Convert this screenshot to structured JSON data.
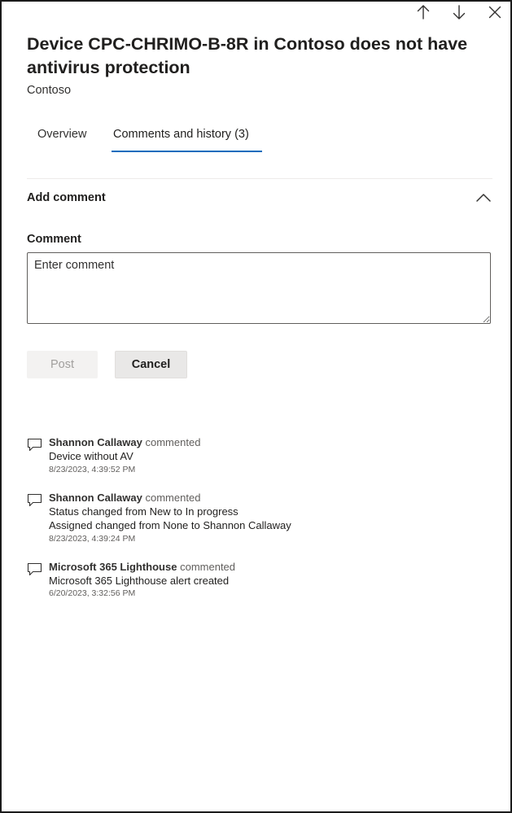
{
  "panel": {
    "title": "Device CPC-CHRIMO-B-8R in Contoso does not have antivirus protection",
    "subtitle": "Contoso"
  },
  "actions": {
    "icons": [
      "arrow-up-icon",
      "arrow-down-icon",
      "close-icon"
    ]
  },
  "tabs": [
    {
      "label": "Overview",
      "selected": false
    },
    {
      "label": "Comments and history (3)",
      "selected": true
    }
  ],
  "add_comment": {
    "heading": "Add comment",
    "expanded": true,
    "field_label": "Comment",
    "placeholder": "Enter comment",
    "value": "",
    "post_label": "Post",
    "cancel_label": "Cancel"
  },
  "history": [
    {
      "author": "Shannon Callaway",
      "verb": "commented",
      "lines": [
        "Device without AV"
      ],
      "timestamp": "8/23/2023, 4:39:52 PM"
    },
    {
      "author": "Shannon Callaway",
      "verb": "commented",
      "lines": [
        "Status changed from New to In progress",
        "Assigned changed from None to Shannon Callaway"
      ],
      "timestamp": "8/23/2023, 4:39:24 PM"
    },
    {
      "author": "Microsoft 365 Lighthouse",
      "verb": "commented",
      "lines": [
        "Microsoft 365 Lighthouse alert created"
      ],
      "timestamp": "6/20/2023, 3:32:56 PM"
    }
  ],
  "colors": {
    "accent": "#0f6cbd",
    "text": "#201f1e",
    "secondary_text": "#605e5c",
    "disabled_button_bg": "#f3f2f1"
  }
}
